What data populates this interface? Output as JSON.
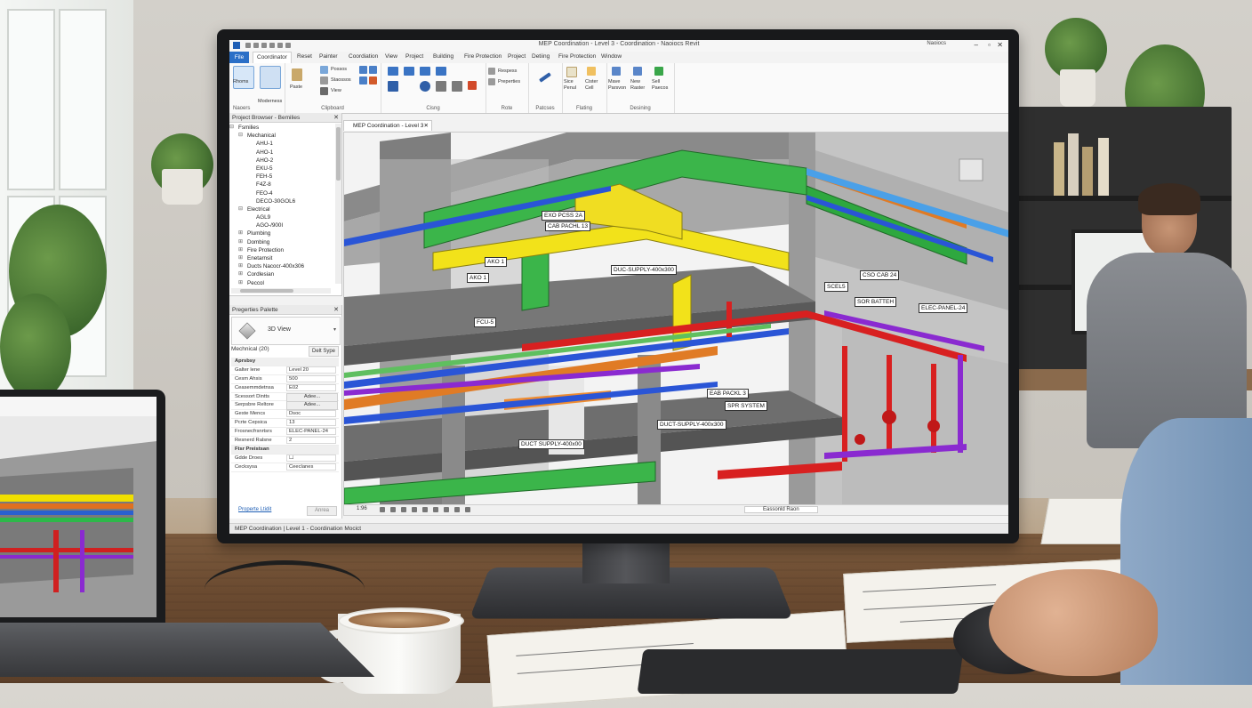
{
  "app": {
    "title": "MEP Coordination - Level 3 - Coordination - Naoiocs Revit",
    "user": "Naoiocs"
  },
  "ribbon": {
    "tabs": [
      "File",
      "Coordinator",
      "Reset",
      "Painter",
      "Coordiation",
      "View",
      "Project",
      "Building",
      "Fire Protection",
      "Project",
      "Detiing",
      "Fire Protection",
      "Window"
    ],
    "active_tab": "Coordinator",
    "groups": [
      {
        "label": "Naoers",
        "buttons": [
          "Rhoms",
          "Moderness"
        ]
      },
      {
        "label": "Clipboard",
        "buttons": [
          "Paste",
          "Possos",
          "Staossos",
          "View"
        ]
      },
      {
        "label": "Cisng",
        "buttons": []
      },
      {
        "label": "Rote",
        "buttons": [
          "Respess",
          "Preperties"
        ]
      },
      {
        "label": "Patcses",
        "buttons": []
      },
      {
        "label": "Flating",
        "buttons": [
          "Sice Penul",
          "Cister Cell"
        ]
      },
      {
        "label": "Desining",
        "buttons": [
          "Mave Parsvon",
          "New Raster",
          "Sell Paecos"
        ]
      }
    ]
  },
  "project_browser": {
    "title": "Project Browser - Bemilies",
    "items": [
      {
        "label": "Fsmilies",
        "level": 0,
        "toggle": "⊟"
      },
      {
        "label": "Mechanical",
        "level": 1,
        "toggle": "⊟"
      },
      {
        "label": "AHU-1",
        "level": 2,
        "toggle": ""
      },
      {
        "label": "AHO-1",
        "level": 2,
        "toggle": ""
      },
      {
        "label": "AHO-2",
        "level": 2,
        "toggle": ""
      },
      {
        "label": "EKU-5",
        "level": 2,
        "toggle": ""
      },
      {
        "label": "FEH-5",
        "level": 2,
        "toggle": ""
      },
      {
        "label": "F4Z-8",
        "level": 2,
        "toggle": ""
      },
      {
        "label": "FEO-4",
        "level": 2,
        "toggle": ""
      },
      {
        "label": "DECO-30GOL6",
        "level": 2,
        "toggle": ""
      },
      {
        "label": "Electrical",
        "level": 1,
        "toggle": "⊟"
      },
      {
        "label": "AGL9",
        "level": 2,
        "toggle": ""
      },
      {
        "label": "AGO-/900I",
        "level": 2,
        "toggle": ""
      },
      {
        "label": "Plumbing",
        "level": 1,
        "toggle": "⊞"
      },
      {
        "label": "Dombing",
        "level": 1,
        "toggle": "⊞"
      },
      {
        "label": "Fire Protection",
        "level": 1,
        "toggle": "⊞"
      },
      {
        "label": "Enetarnsit",
        "level": 1,
        "toggle": "⊞"
      },
      {
        "label": "Ducts Nacocr-400x306",
        "level": 1,
        "toggle": "⊞"
      },
      {
        "label": "Cordlesian",
        "level": 1,
        "toggle": "⊞"
      },
      {
        "label": "Peccol",
        "level": 1,
        "toggle": "⊞"
      }
    ]
  },
  "properties": {
    "title": "Pregerties Palette",
    "type": "3D View",
    "selection": "Mechnical (20)",
    "edit_type": "Delt Sype",
    "rows": [
      {
        "section": true,
        "key": "Aprsbsy",
        "value": ""
      },
      {
        "key": "Galter lene",
        "value": "Level 20"
      },
      {
        "key": "Cesm Ahsis",
        "value": "500"
      },
      {
        "key": "Ceasemmdetnsa",
        "value": "E02"
      },
      {
        "key": "Scessort Dintts",
        "value": "Adee...",
        "button": true
      },
      {
        "key": "Serpsbre Reltore",
        "value": "Adee...",
        "button": true
      },
      {
        "key": "Geste Mencs",
        "value": "Dsoc"
      },
      {
        "key": "Pcrte Cepsica",
        "value": "13"
      },
      {
        "key": "Frosnecfrsnrtsrs",
        "value": "ELEC-PANEL-24"
      },
      {
        "key": "Resnerd Ralsne",
        "value": "2"
      },
      {
        "section": true,
        "key": "Ftsr Preistsan",
        "value": ""
      },
      {
        "key": "Gdde Droes",
        "value": "☐"
      },
      {
        "key": "Cecksysa",
        "value": "Ceeclanes"
      }
    ],
    "help_link": "Properte Ltidit",
    "apply": "Anrea"
  },
  "view": {
    "tab_label": "MEP Coordination - Level 3",
    "scale": "1:96",
    "bottom_field": "Eassonld Raon"
  },
  "tags": [
    "EXO PCSS 2A",
    "CAB PACHL 13",
    "AKO 1",
    "DUC-SUPPLY-400x300",
    "AKO 1",
    "FCU-5",
    "CSO CAB 24",
    "SCEL5",
    "SOR BATTEH",
    "ELEC-PANEL-24",
    "EAB PACKL 3",
    "SPR SYSTEM",
    "DUCT-SUPPLY-400x300",
    "DUCT SUPPLY-400x00"
  ],
  "status": {
    "text": "MEP Coordination | Level 1 - Coordination Mocict"
  }
}
